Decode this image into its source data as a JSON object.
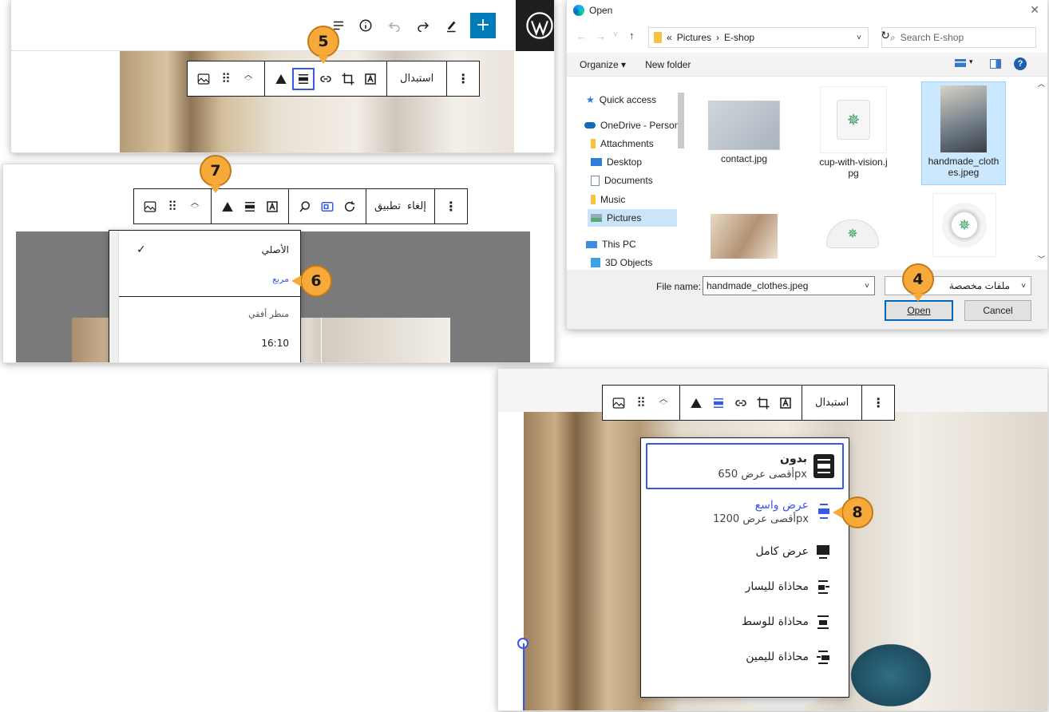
{
  "badges": {
    "b4": "4",
    "b5": "5",
    "b6": "6",
    "b7": "7",
    "b8": "8"
  },
  "toolbar1": {
    "replace_label": "استبدال"
  },
  "crop": {
    "apply_label": "تطبيق",
    "cancel_label": "إلغاء",
    "items": {
      "original": "الأصلي",
      "square": "مربع",
      "landscape": "منظر أفقي",
      "ratio_16_10": "16:10"
    }
  },
  "dialog": {
    "title": "Open",
    "breadcrumb": {
      "sep": "«",
      "pictures": "Pictures",
      "eshop": "E-shop"
    },
    "search_placeholder": "Search E-shop",
    "organize": "Organize ▾",
    "new_folder": "New folder",
    "nav": {
      "quick_access": "Quick access",
      "onedrive": "OneDrive - Person",
      "attachments": "Attachments",
      "desktop": "Desktop",
      "documents": "Documents",
      "music": "Music",
      "pictures": "Pictures",
      "this_pc": "This PC",
      "objects3d": "3D Objects"
    },
    "files": {
      "f1": "contact.jpg",
      "f2a": "cup-with-vision.j",
      "f2b": "pg",
      "f3a": "handmade_cloth",
      "f3b": "es.jpeg"
    },
    "filename_label": "File name:",
    "filename_value": "handmade_clothes.jpeg",
    "filetype_value": "ملفات مخصصة",
    "open_label": "Open",
    "cancel_label": "Cancel"
  },
  "toolbar3": {
    "replace_label": "استبدال"
  },
  "align_menu": {
    "none": {
      "label": "بدون",
      "desc": "أقصى عرض 650px"
    },
    "wide": {
      "label": "عرض واسع",
      "desc": "أقصى عرض 1200px"
    },
    "full": {
      "label": "عرض كامل"
    },
    "left": {
      "label": "محاذاة لليسار"
    },
    "center": {
      "label": "محاذاة للوسط"
    },
    "right": {
      "label": "محاذاة لليمين"
    }
  },
  "colors": {
    "accent": "#3858e9",
    "wp_blue": "#007cba",
    "badge": "#f7a93a",
    "win_blue": "#0067c0"
  }
}
